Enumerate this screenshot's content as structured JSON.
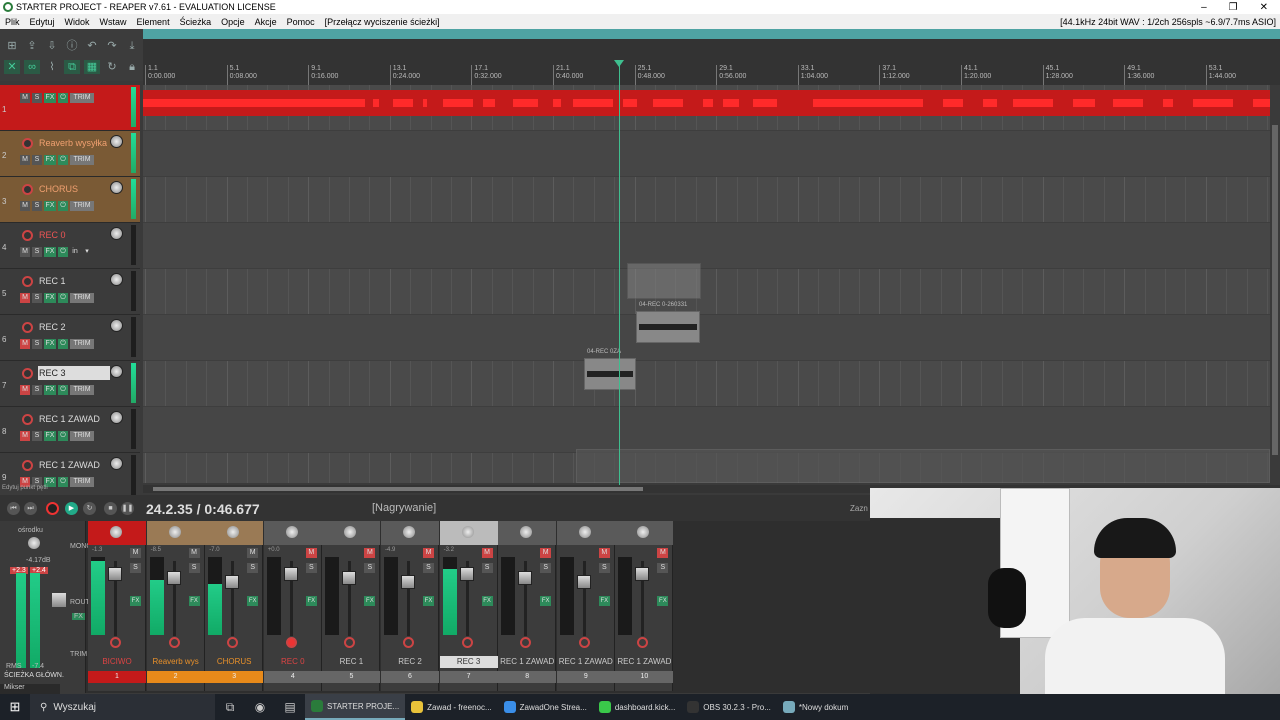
{
  "window": {
    "title": "STARTER PROJECT - REAPER v7.61 - EVALUATION LICENSE",
    "controls": [
      "–",
      "❐",
      "✕"
    ]
  },
  "menu": {
    "items": [
      "Plik",
      "Edytuj",
      "Widok",
      "Wstaw",
      "Element",
      "Ścieżka",
      "Opcje",
      "Akcje",
      "Pomoc"
    ],
    "toggle": "[Przełącz wyciszenie ścieżki]",
    "audio_status": "[44.1kHz 24bit WAV : 1/2ch 256spls ~6.9/7.7ms ASIO]"
  },
  "ruler": {
    "ticks": [
      {
        "bar": "1.1",
        "time": "0:00.000"
      },
      {
        "bar": "5.1",
        "time": "0:08.000"
      },
      {
        "bar": "9.1",
        "time": "0:16.000"
      },
      {
        "bar": "13.1",
        "time": "0:24.000"
      },
      {
        "bar": "17.1",
        "time": "0:32.000"
      },
      {
        "bar": "21.1",
        "time": "0:40.000"
      },
      {
        "bar": "25.1",
        "time": "0:48.000"
      },
      {
        "bar": "29.1",
        "time": "0:56.000"
      },
      {
        "bar": "33.1",
        "time": "1:04.000"
      },
      {
        "bar": "37.1",
        "time": "1:12.000"
      },
      {
        "bar": "41.1",
        "time": "1:20.000"
      },
      {
        "bar": "45.1",
        "time": "1:28.000"
      },
      {
        "bar": "49.1",
        "time": "1:36.000"
      },
      {
        "bar": "53.1",
        "time": "1:44.000"
      }
    ]
  },
  "tracks": [
    {
      "num": "1",
      "name": "",
      "color": "#c41a1a"
    },
    {
      "num": "2",
      "name": "Reaverb wysyłka",
      "color": "#7a5a35"
    },
    {
      "num": "3",
      "name": "CHORUS",
      "color": "#7a5a35"
    },
    {
      "num": "4",
      "name": "REC 0",
      "color": "#3b3b3b"
    },
    {
      "num": "5",
      "name": "REC 1",
      "color": "#3b3b3b"
    },
    {
      "num": "6",
      "name": "REC 2",
      "color": "#3b3b3b"
    },
    {
      "num": "7",
      "name": "REC 3",
      "color": "#3b3b3b"
    },
    {
      "num": "8",
      "name": "REC 1 ZAWAD",
      "color": "#3b3b3b"
    },
    {
      "num": "9",
      "name": "REC 1 ZAWAD",
      "color": "#3b3b3b"
    }
  ],
  "track_buttons": {
    "mute": "M",
    "solo": "S",
    "fx": "FX",
    "io": "⏻",
    "trim": "TRIM",
    "in": "in"
  },
  "items": {
    "rec2_item": "04-REC 0-260331",
    "rec3_item": "04-REC 0ZA"
  },
  "status_hint": "Edytuj punkt pętli",
  "transport": {
    "position": "24.2.35 / 0:46.677",
    "state": "[Nagrywanie]",
    "zazn": "Zazn"
  },
  "master": {
    "center_label": "ośrodku",
    "peak_l": "-4.17dB",
    "peak_a": "+2.3",
    "peak_b": "+2.4",
    "rms_l": "RMS",
    "rms_r": "-7.4",
    "name": "ŚCIEŻKA GŁÓWN.",
    "mono": "MONO",
    "route": "ROUTE",
    "fx": "FX",
    "trim": "TRIM"
  },
  "mixer_strips": [
    {
      "name": "BICIWO",
      "num": "1",
      "name_color": "#d44",
      "num_color": "#c41a1a",
      "db": "-1.3",
      "level": 0.95
    },
    {
      "name": "Reaverb wys",
      "num": "2",
      "name_color": "#e8902a",
      "num_color": "#e88a1a",
      "db": "-8.5",
      "level": 0.7
    },
    {
      "name": "CHORUS",
      "num": "3",
      "name_color": "#e8902a",
      "num_color": "#e88a1a",
      "db": "-7.0",
      "level": 0.65
    },
    {
      "name": "REC 0",
      "num": "4",
      "name_color": "#d44",
      "num_color": "#666",
      "db": "+0.0",
      "level": 0.0
    },
    {
      "name": "REC 1",
      "num": "5",
      "name_color": "#ccc",
      "num_color": "#666",
      "db": "",
      "level": 0.0
    },
    {
      "name": "REC 2",
      "num": "6",
      "name_color": "#ccc",
      "num_color": "#666",
      "db": "-4.9",
      "level": 0.0
    },
    {
      "name": "REC 3",
      "num": "7",
      "name_color": "#333",
      "num_color": "#666",
      "db": "-3.2",
      "level": 0.85
    },
    {
      "name": "REC 1 ZAWAD",
      "num": "8",
      "name_color": "#ccc",
      "num_color": "#666",
      "db": "",
      "level": 0.0
    },
    {
      "name": "REC 1 ZAWAD",
      "num": "9",
      "name_color": "#ccc",
      "num_color": "#666",
      "db": "",
      "level": 0.0
    },
    {
      "name": "REC 1 ZAWAD",
      "num": "10",
      "name_color": "#ccc",
      "num_color": "#666",
      "db": "",
      "level": 0.0
    }
  ],
  "mixer_tab": "Mikser",
  "taskbar": {
    "search": "Wyszukaj",
    "tasks": [
      {
        "label": "STARTER PROJE...",
        "color": "#2a7b3b"
      },
      {
        "label": "Zawad - freenoc...",
        "color": "#e8c23a"
      },
      {
        "label": "ZawadOne Strea...",
        "color": "#3a8ee8"
      },
      {
        "label": "dashboard.kick...",
        "color": "#3ac84a"
      },
      {
        "label": "OBS 30.2.3 - Pro...",
        "color": "#333"
      },
      {
        "label": "*Nowy dokum",
        "color": "#7ab"
      }
    ]
  }
}
